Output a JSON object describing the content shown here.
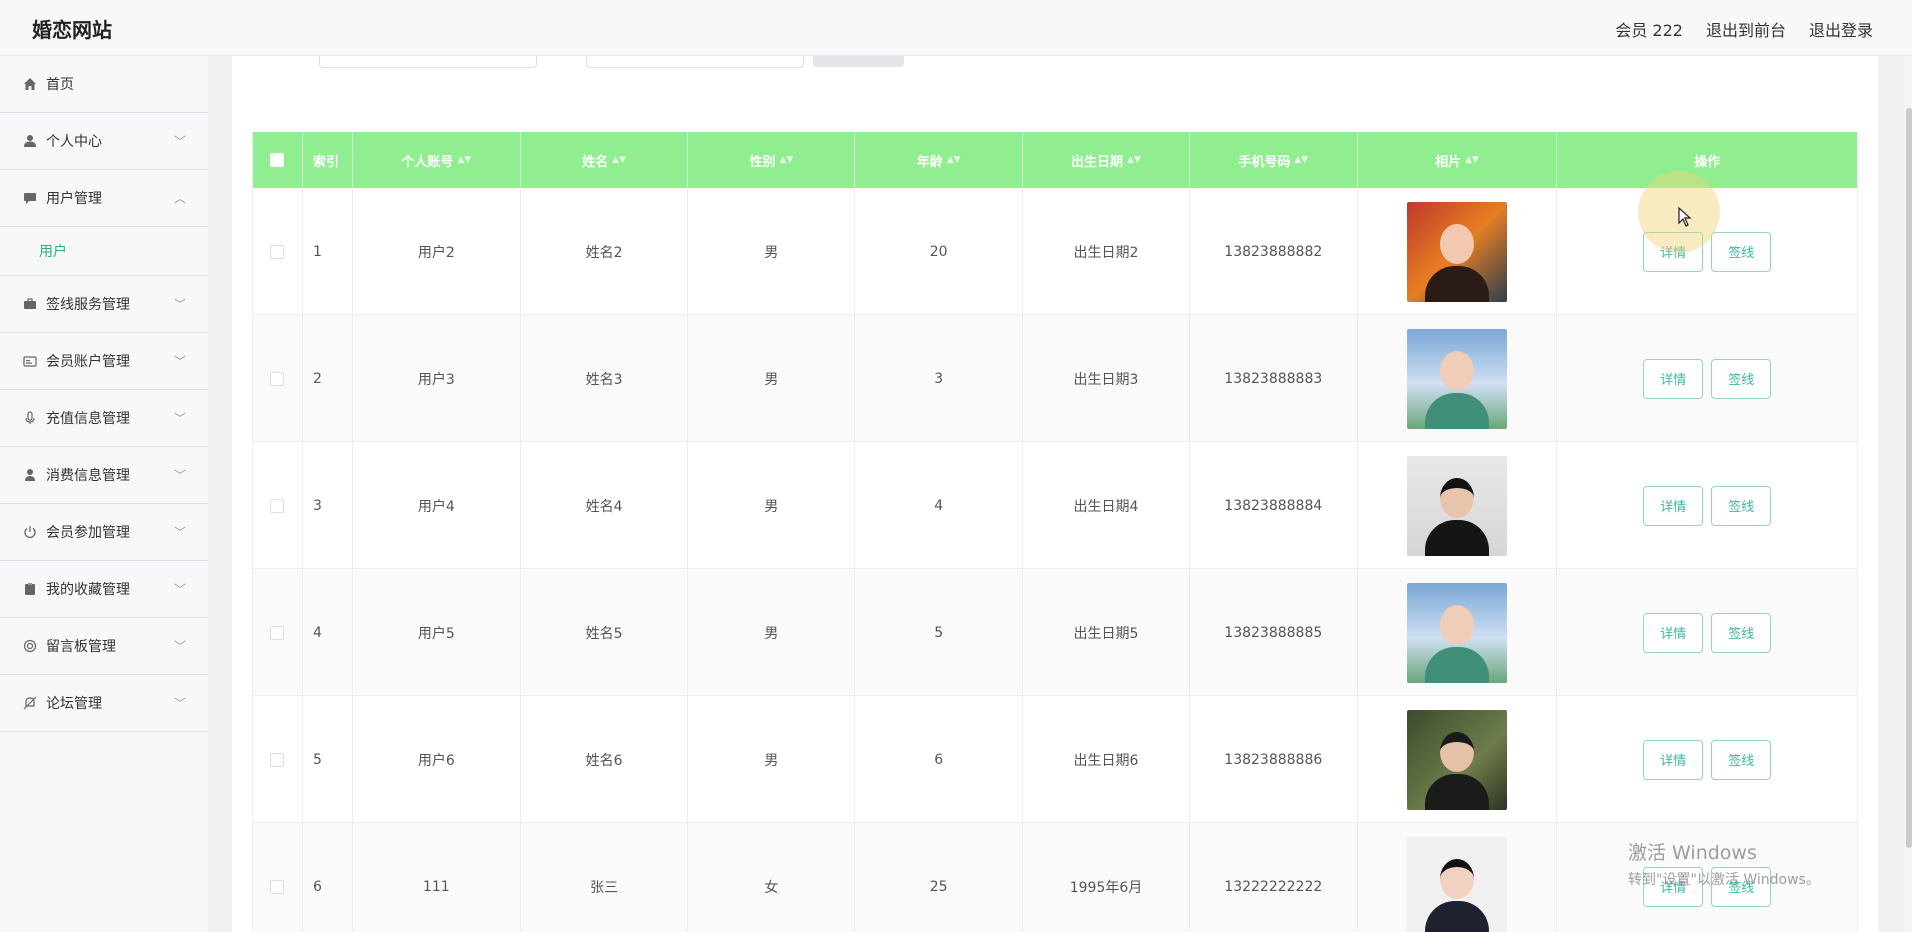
{
  "header": {
    "site_title": "婚恋网站",
    "member_label": "会员 222",
    "back_to_front": "退出到前台",
    "logout": "退出登录"
  },
  "sidebar": {
    "items": [
      {
        "label": "首页",
        "icon": "home-icon",
        "chevron": ""
      },
      {
        "label": "个人中心",
        "icon": "user-icon",
        "chevron": "﹀"
      },
      {
        "label": "用户管理",
        "icon": "chat-icon",
        "chevron": "︿"
      },
      {
        "label": "签线服务管理",
        "icon": "briefcase-icon",
        "chevron": "﹀"
      },
      {
        "label": "会员账户管理",
        "icon": "id-card-icon",
        "chevron": "﹀"
      },
      {
        "label": "充值信息管理",
        "icon": "microphone-icon",
        "chevron": "﹀"
      },
      {
        "label": "消费信息管理",
        "icon": "person-icon",
        "chevron": "﹀"
      },
      {
        "label": "会员参加管理",
        "icon": "power-icon",
        "chevron": "﹀"
      },
      {
        "label": "我的收藏管理",
        "icon": "clipboard-icon",
        "chevron": "﹀"
      },
      {
        "label": "留言板管理",
        "icon": "message-circle-icon",
        "chevron": "﹀"
      },
      {
        "label": "论坛管理",
        "icon": "bell-off-icon",
        "chevron": "﹀"
      }
    ],
    "sub_items": [
      {
        "label": "用户"
      }
    ]
  },
  "table": {
    "columns": [
      "索引",
      "个人账号",
      "姓名",
      "性别",
      "年龄",
      "出生日期",
      "手机号码",
      "相片",
      "操作"
    ],
    "rows": [
      {
        "index": "1",
        "account": "用户2",
        "name": "姓名2",
        "gender": "男",
        "age": "20",
        "birth": "出生日期2",
        "phone": "13823888882"
      },
      {
        "index": "2",
        "account": "用户3",
        "name": "姓名3",
        "gender": "男",
        "age": "3",
        "birth": "出生日期3",
        "phone": "13823888883"
      },
      {
        "index": "3",
        "account": "用户4",
        "name": "姓名4",
        "gender": "男",
        "age": "4",
        "birth": "出生日期4",
        "phone": "13823888884"
      },
      {
        "index": "4",
        "account": "用户5",
        "name": "姓名5",
        "gender": "男",
        "age": "5",
        "birth": "出生日期5",
        "phone": "13823888885"
      },
      {
        "index": "5",
        "account": "用户6",
        "name": "姓名6",
        "gender": "男",
        "age": "6",
        "birth": "出生日期6",
        "phone": "13823888886"
      },
      {
        "index": "6",
        "account": "111",
        "name": "张三",
        "gender": "女",
        "age": "25",
        "birth": "1995年6月",
        "phone": "13222222222"
      }
    ],
    "detail_label": "详情",
    "sign_label": "签线"
  },
  "watermark": {
    "line1": "激活 Windows",
    "line2": "转到\"设置\"以激活 Windows。"
  },
  "colors": {
    "header_green": "#90ee90",
    "accent": "#26b37a",
    "button_text": "#3ab8a6"
  }
}
